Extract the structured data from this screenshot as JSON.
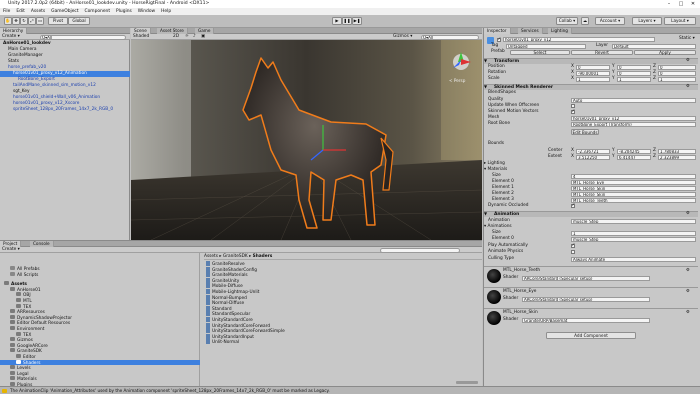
{
  "window": {
    "title": "Unity 2017.2.0p2 (64bit) - AnHorse01_lookdev.unity - HorseRigtFinal - Android <DX11>"
  },
  "menu": [
    "File",
    "Edit",
    "Assets",
    "GameObject",
    "Component",
    "Plugins",
    "Window",
    "Help"
  ],
  "toolbar": {
    "pivot": "Pivot",
    "global": "Global",
    "collab": "Collab ▾",
    "account": "Account ▾",
    "layers": "Layers ▾",
    "layout": "Layout ▾"
  },
  "hierarchy": {
    "tab": "Hierarchy",
    "create": "Create ▾",
    "search_placeholder": "Q▾All",
    "items": [
      {
        "label": "AnHorse01_lookdev",
        "indent": 0,
        "state": "scene"
      },
      {
        "label": "Main Camera",
        "indent": 1,
        "state": "normal"
      },
      {
        "label": "GraniteManager",
        "indent": 1,
        "state": "normal"
      },
      {
        "label": "Stats",
        "indent": 1,
        "state": "normal"
      },
      {
        "label": "horse_prefab_v20",
        "indent": 1,
        "state": "prefab"
      },
      {
        "label": "horse01v01_proxy_v12_Animation",
        "indent": 2,
        "state": "selected"
      },
      {
        "label": "RootBone_Export",
        "indent": 3,
        "state": "prefab"
      },
      {
        "label": "tailAndMane_skinned_sim_motion_v12",
        "indent": 2,
        "state": "prefab"
      },
      {
        "label": "sgt_Key",
        "indent": 2,
        "state": "normal"
      },
      {
        "label": "horse01v01_shield+Wall_v06_Animation",
        "indent": 2,
        "state": "prefab"
      },
      {
        "label": "horse01v01_proxy_v12_Xscore",
        "indent": 2,
        "state": "prefab"
      },
      {
        "label": "spriteSheet_128px_20Frames_14x7_2k_RGB_0",
        "indent": 2,
        "state": "prefab"
      }
    ]
  },
  "scene": {
    "tabs": [
      "Scene",
      "Asset Store",
      "Game"
    ],
    "shading": "Shaded",
    "mode2d": "2D",
    "gizmos": "Gizmos ▾",
    "search_placeholder": "Q▾All",
    "persp": "< Persp"
  },
  "inspector": {
    "tabs": [
      "Inspector",
      "Services",
      "Lighting"
    ],
    "object_name": "horse01v01_proxy_v12",
    "static": "Static ▾",
    "tag_label": "Tag",
    "tag_value": "Untagged",
    "layer_label": "Layer",
    "layer_value": "Default",
    "prefab_label": "Prefab",
    "prefab_select": "Select",
    "prefab_revert": "Revert",
    "prefab_apply": "Apply",
    "transform": {
      "title": "Transform",
      "position": {
        "label": "Position",
        "x": "0",
        "y": "0",
        "z": "0"
      },
      "rotation": {
        "label": "Rotation",
        "x": "-90.00001",
        "y": "0",
        "z": "0"
      },
      "scale": {
        "label": "Scale",
        "x": "1",
        "y": "1",
        "z": "1"
      }
    },
    "smr": {
      "title": "Skinned Mesh Renderer",
      "blendshapes": "BlendShapes",
      "quality_label": "Quality",
      "quality_value": "Auto",
      "update_offscreen": "Update When Offscreen",
      "skinned_motion": "Skinned Motion Vectors",
      "mesh_label": "Mesh",
      "mesh_value": "horse01v01_proxy_v12",
      "rootbone_label": "Root Bone",
      "rootbone_value": "RootBone_Export (Transform)",
      "edit_bounds": "Edit Bounds",
      "bounds_label": "Bounds",
      "center_label": "Center",
      "center_x": "-2.336721",
      "center_y": "-8.204245",
      "center_z": "1.780833",
      "extent_label": "Extent",
      "extent_x": "3.512250",
      "extent_y": "6.41447",
      "extent_z": "2.323899",
      "lighting": "Lighting",
      "materials": "Materials",
      "size_label": "Size",
      "size_value": "4",
      "elements": [
        {
          "label": "Element 0",
          "value": "MTL_Horse_Eye"
        },
        {
          "label": "Element 1",
          "value": "MTL_Horse_Skin"
        },
        {
          "label": "Element 2",
          "value": "MTL_Horse_Skin"
        },
        {
          "label": "Element 3",
          "value": "MTL_Horse_Teeth"
        }
      ],
      "dynamic_occluded": "Dynamic Occluded"
    },
    "animation": {
      "title": "Animation",
      "animation_label": "Animation",
      "animation_value": "muscle_Step",
      "animations_label": "Animations",
      "size_label": "Size",
      "size_value": "1",
      "element0_label": "Element 0",
      "element0_value": "muscle_Step",
      "play_auto": "Play Automatically",
      "animate_physics": "Animate Physics",
      "culling_label": "Culling Type",
      "culling_value": "Always Animate"
    },
    "materials": [
      {
        "name": "MTL_Horse_Teeth",
        "shader_label": "Shader",
        "shader_value": "ARCore/Standard (Specular setup)"
      },
      {
        "name": "MTL_Horse_Eye",
        "shader_label": "Shader",
        "shader_value": "ARCore/Standard (Specular setup)"
      },
      {
        "name": "MTL_Horse_Skin",
        "shader_label": "Shader",
        "shader_value": "Granite/URP/Basemat"
      }
    ],
    "add_component": "Add Component"
  },
  "project": {
    "tabs": [
      "Project",
      "Console"
    ],
    "create": "Create ▾",
    "tree": [
      {
        "label": "All Prefabs",
        "indent": 1,
        "type": "search"
      },
      {
        "label": "All Scripts",
        "indent": 1,
        "type": "search"
      },
      {
        "label": "Assets",
        "indent": 0,
        "type": "bold"
      },
      {
        "label": "AnHorse01",
        "indent": 1,
        "type": "folder"
      },
      {
        "label": "OBJ",
        "indent": 2,
        "type": "folder"
      },
      {
        "label": "MTL",
        "indent": 2,
        "type": "folder"
      },
      {
        "label": "TEX",
        "indent": 2,
        "type": "folder"
      },
      {
        "label": "ARResources",
        "indent": 1,
        "type": "folder"
      },
      {
        "label": "DynamicShadowProjector",
        "indent": 1,
        "type": "folder"
      },
      {
        "label": "Editor Default Resources",
        "indent": 1,
        "type": "folder"
      },
      {
        "label": "Environment",
        "indent": 1,
        "type": "folder"
      },
      {
        "label": "TEX",
        "indent": 2,
        "type": "folder"
      },
      {
        "label": "Gizmos",
        "indent": 1,
        "type": "folder"
      },
      {
        "label": "GoogleARCore",
        "indent": 1,
        "type": "folder"
      },
      {
        "label": "GraniteSDK",
        "indent": 1,
        "type": "folder"
      },
      {
        "label": "Editor",
        "indent": 2,
        "type": "folder"
      },
      {
        "label": "Shaders",
        "indent": 2,
        "type": "selected"
      },
      {
        "label": "Levels",
        "indent": 1,
        "type": "folder"
      },
      {
        "label": "Legal",
        "indent": 1,
        "type": "folder"
      },
      {
        "label": "Materials",
        "indent": 1,
        "type": "folder"
      },
      {
        "label": "Plugins",
        "indent": 1,
        "type": "folder"
      },
      {
        "label": "Scripts",
        "indent": 1,
        "type": "folder"
      }
    ],
    "breadcrumb": [
      "Assets",
      "GraniteSDK",
      "Shaders"
    ],
    "files": [
      "GraniteResolve",
      "GraniteShaderConfig",
      "GraniteMaterials",
      "GraniteUnity",
      "Mobile-Diffuse",
      "Mobile-Lightmap-Unlit",
      "Normal-Bumped",
      "Normal-Diffuse",
      "Standard",
      "StandardSpecular",
      "UnityStandardCore",
      "UnityStandardCoreForward",
      "UnityStandardCoreForwardSimple",
      "UnityStandardInput",
      "Unlit-Normal"
    ]
  },
  "status": {
    "text": "The AnimationClip 'Animation_Attributes' used by the Animation component 'spriteSheet_128px_20Frames_14x7_2k_RGB_0' must be marked as Legacy."
  }
}
